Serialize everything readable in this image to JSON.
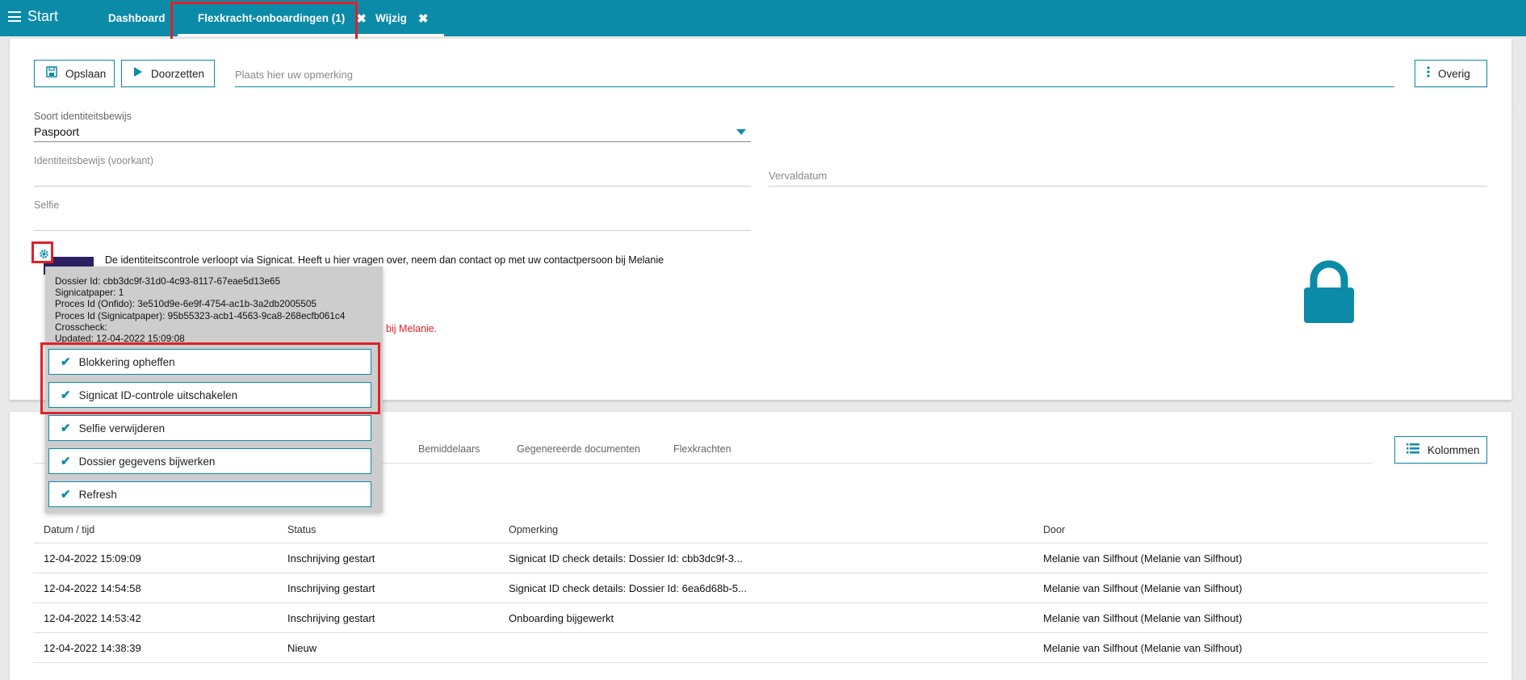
{
  "topbar": {
    "menu_label": "Start",
    "tabs": [
      {
        "label": "Dashboard"
      },
      {
        "label": "Flexkracht-onboardingen (1)",
        "close": "✖"
      },
      {
        "label": "Wijzig",
        "close": "✖"
      }
    ]
  },
  "toolbar": {
    "save_label": "Opslaan",
    "forward_label": "Doorzetten",
    "remark_placeholder": "Plaats hier uw opmerking",
    "more_label": "Overig"
  },
  "form": {
    "id_type_label": "Soort identiteitsbewijs",
    "id_type_value": "Paspoort",
    "id_front_label": "Identiteitsbewijs (voorkant)",
    "expiry_label": "Vervaldatum",
    "selfie_label": "Selfie",
    "signicat_info": "De identiteitscontrole verloopt via Signicat. Heeft u hier vragen over, neem dan contact op met uw contactpersoon bij Melanie",
    "warning_tail": "bij Melanie."
  },
  "popup": {
    "details": [
      "Dossier Id: cbb3dc9f-31d0-4c93-8117-67eae5d13e65",
      "Signicatpaper: 1",
      "Proces Id (Onfido): 3e510d9e-6e9f-4754-ac1b-3a2db2005505",
      "Proces Id (Signicatpaper): 95b55323-acb1-4563-9ca8-268ecfb061c4",
      "Crosscheck:",
      "Updated: 12-04-2022 15:09:08"
    ],
    "actions": [
      {
        "label": "Blokkering opheffen"
      },
      {
        "label": "Signicat ID-controle uitschakelen"
      },
      {
        "label": "Selfie verwijderen"
      },
      {
        "label": "Dossier gegevens bijwerken"
      },
      {
        "label": "Refresh"
      }
    ]
  },
  "subtabs": [
    "Bemiddelaars",
    "Gegenereerde documenten",
    "Flexkrachten"
  ],
  "columns_button": "Kolommen",
  "table": {
    "headers": [
      "Datum / tijd",
      "Status",
      "Opmerking",
      "Door"
    ],
    "rows": [
      [
        "12-04-2022 15:09:09",
        "Inschrijving gestart",
        "Signicat ID check details: Dossier Id: cbb3dc9f-3...",
        "Melanie van Silfhout (Melanie van Silfhout)"
      ],
      [
        "12-04-2022 14:54:58",
        "Inschrijving gestart",
        "Signicat ID check details: Dossier Id: 6ea6d68b-5...",
        "Melanie van Silfhout (Melanie van Silfhout)"
      ],
      [
        "12-04-2022 14:53:42",
        "Inschrijving gestart",
        "Onboarding bijgewerkt",
        "Melanie van Silfhout (Melanie van Silfhout)"
      ],
      [
        "12-04-2022 14:38:39",
        "Nieuw",
        "",
        "Melanie van Silfhout (Melanie van Silfhout)"
      ]
    ]
  },
  "colors": {
    "accent": "#0b8ba8",
    "highlight": "#e0202a",
    "logo": "#2c1f63"
  },
  "icons": [
    "hamburger-icon",
    "close-icon",
    "save-icon",
    "play-icon",
    "more-vertical-icon",
    "gear-icon",
    "lock-icon",
    "check-icon",
    "list-icon",
    "chevron-down-icon"
  ]
}
